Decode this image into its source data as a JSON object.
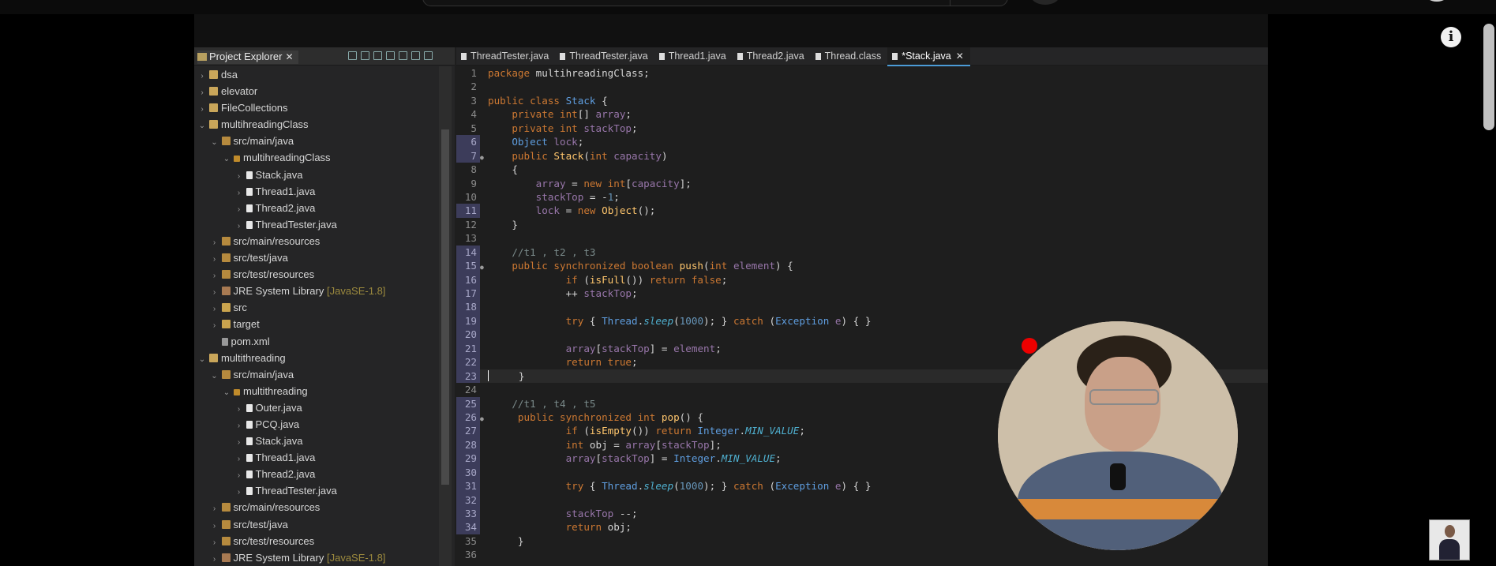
{
  "project_explorer": {
    "title": "Project Explorer",
    "close": "✕",
    "items": [
      {
        "depth": 0,
        "arrow": "›",
        "icon": "proj",
        "label": "dsa",
        "extra": ""
      },
      {
        "depth": 0,
        "arrow": "›",
        "icon": "proj",
        "label": "elevator",
        "extra": ""
      },
      {
        "depth": 0,
        "arrow": "›",
        "icon": "proj",
        "label": "FileCollections",
        "extra": ""
      },
      {
        "depth": 0,
        "arrow": "⌄",
        "icon": "proj",
        "label": "multihreadingClass",
        "extra": ""
      },
      {
        "depth": 1,
        "arrow": "⌄",
        "icon": "pkgf",
        "label": "src/main/java",
        "extra": ""
      },
      {
        "depth": 2,
        "arrow": "⌄",
        "icon": "pkg",
        "label": "multihreadingClass",
        "extra": ""
      },
      {
        "depth": 3,
        "arrow": "›",
        "icon": "java",
        "label": "Stack.java",
        "extra": ""
      },
      {
        "depth": 3,
        "arrow": "›",
        "icon": "java",
        "label": "Thread1.java",
        "extra": ""
      },
      {
        "depth": 3,
        "arrow": "›",
        "icon": "java",
        "label": "Thread2.java",
        "extra": ""
      },
      {
        "depth": 3,
        "arrow": "›",
        "icon": "java",
        "label": "ThreadTester.java",
        "extra": ""
      },
      {
        "depth": 1,
        "arrow": "›",
        "icon": "pkgf",
        "label": "src/main/resources",
        "extra": ""
      },
      {
        "depth": 1,
        "arrow": "›",
        "icon": "pkgf",
        "label": "src/test/java",
        "extra": ""
      },
      {
        "depth": 1,
        "arrow": "›",
        "icon": "pkgf",
        "label": "src/test/resources",
        "extra": ""
      },
      {
        "depth": 1,
        "arrow": "›",
        "icon": "lib",
        "label": "JRE System Library",
        "extra": " [JavaSE-1.8]"
      },
      {
        "depth": 1,
        "arrow": "›",
        "icon": "folder",
        "label": "src",
        "extra": ""
      },
      {
        "depth": 1,
        "arrow": "›",
        "icon": "folder",
        "label": "target",
        "extra": ""
      },
      {
        "depth": 1,
        "arrow": "",
        "icon": "xml",
        "label": "pom.xml",
        "extra": ""
      },
      {
        "depth": 0,
        "arrow": "⌄",
        "icon": "proj",
        "label": "multithreading",
        "extra": ""
      },
      {
        "depth": 1,
        "arrow": "⌄",
        "icon": "pkgf",
        "label": "src/main/java",
        "extra": ""
      },
      {
        "depth": 2,
        "arrow": "⌄",
        "icon": "pkg",
        "label": "multithreading",
        "extra": ""
      },
      {
        "depth": 3,
        "arrow": "›",
        "icon": "java",
        "label": "Outer.java",
        "extra": ""
      },
      {
        "depth": 3,
        "arrow": "›",
        "icon": "java",
        "label": "PCQ.java",
        "extra": ""
      },
      {
        "depth": 3,
        "arrow": "›",
        "icon": "java",
        "label": "Stack.java",
        "extra": ""
      },
      {
        "depth": 3,
        "arrow": "›",
        "icon": "java",
        "label": "Thread1.java",
        "extra": ""
      },
      {
        "depth": 3,
        "arrow": "›",
        "icon": "java",
        "label": "Thread2.java",
        "extra": ""
      },
      {
        "depth": 3,
        "arrow": "›",
        "icon": "java",
        "label": "ThreadTester.java",
        "extra": ""
      },
      {
        "depth": 1,
        "arrow": "›",
        "icon": "pkgf",
        "label": "src/main/resources",
        "extra": ""
      },
      {
        "depth": 1,
        "arrow": "›",
        "icon": "pkgf",
        "label": "src/test/java",
        "extra": ""
      },
      {
        "depth": 1,
        "arrow": "›",
        "icon": "pkgf",
        "label": "src/test/resources",
        "extra": ""
      },
      {
        "depth": 1,
        "arrow": "›",
        "icon": "lib",
        "label": "JRE System Library",
        "extra": " [JavaSE-1.8]"
      }
    ]
  },
  "editor": {
    "tabs": [
      {
        "label": "ThreadTester.java",
        "active": false,
        "close": ""
      },
      {
        "label": "ThreadTester.java",
        "active": false,
        "close": ""
      },
      {
        "label": "Thread1.java",
        "active": false,
        "close": ""
      },
      {
        "label": "Thread2.java",
        "active": false,
        "close": ""
      },
      {
        "label": "Thread.class",
        "active": false,
        "close": ""
      },
      {
        "label": "*Stack.java",
        "active": true,
        "close": "✕"
      }
    ],
    "lines": [
      {
        "n": "1",
        "mark": false,
        "fold": "",
        "cur": false,
        "t": [
          [
            "kw",
            "package "
          ],
          [
            "pl",
            "multihreadingClass;"
          ]
        ]
      },
      {
        "n": "2",
        "mark": false,
        "fold": "",
        "cur": false,
        "t": []
      },
      {
        "n": "3",
        "mark": false,
        "fold": "",
        "cur": false,
        "t": [
          [
            "kw",
            "public class "
          ],
          [
            "cls",
            "Stack"
          ],
          [
            "pl",
            " {"
          ]
        ]
      },
      {
        "n": "4",
        "mark": false,
        "fold": "",
        "cur": false,
        "t": [
          [
            "pl",
            "    "
          ],
          [
            "kw",
            "private int"
          ],
          [
            "pl",
            "[] "
          ],
          [
            "var",
            "array"
          ],
          [
            "pl",
            ";"
          ]
        ]
      },
      {
        "n": "5",
        "mark": false,
        "fold": "",
        "cur": false,
        "t": [
          [
            "pl",
            "    "
          ],
          [
            "kw",
            "private int "
          ],
          [
            "var",
            "stackTop"
          ],
          [
            "pl",
            ";"
          ]
        ]
      },
      {
        "n": "6",
        "mark": true,
        "fold": "",
        "cur": false,
        "t": [
          [
            "pl",
            "    "
          ],
          [
            "cls",
            "Object "
          ],
          [
            "var",
            "lock"
          ],
          [
            "pl",
            ";"
          ]
        ]
      },
      {
        "n": "7",
        "mark": true,
        "fold": "●",
        "cur": false,
        "t": [
          [
            "pl",
            "    "
          ],
          [
            "kw",
            "public "
          ],
          [
            "fn",
            "Stack"
          ],
          [
            "pl",
            "("
          ],
          [
            "kw",
            "int "
          ],
          [
            "var",
            "capacity"
          ],
          [
            "pl",
            ")"
          ]
        ]
      },
      {
        "n": "8",
        "mark": false,
        "fold": "",
        "cur": false,
        "t": [
          [
            "pl",
            "    {"
          ]
        ]
      },
      {
        "n": "9",
        "mark": false,
        "fold": "",
        "cur": false,
        "t": [
          [
            "pl",
            "        "
          ],
          [
            "var",
            "array"
          ],
          [
            "pl",
            " = "
          ],
          [
            "kw",
            "new int"
          ],
          [
            "pl",
            "["
          ],
          [
            "var",
            "capacity"
          ],
          [
            "pl",
            "];"
          ]
        ]
      },
      {
        "n": "10",
        "mark": false,
        "fold": "",
        "cur": false,
        "t": [
          [
            "pl",
            "        "
          ],
          [
            "var",
            "stackTop"
          ],
          [
            "pl",
            " = -"
          ],
          [
            "num",
            "1"
          ],
          [
            "pl",
            ";"
          ]
        ]
      },
      {
        "n": "11",
        "mark": true,
        "fold": "",
        "cur": false,
        "t": [
          [
            "pl",
            "        "
          ],
          [
            "var",
            "lock"
          ],
          [
            "pl",
            " = "
          ],
          [
            "kw",
            "new "
          ],
          [
            "fn",
            "Object"
          ],
          [
            "pl",
            "();"
          ]
        ]
      },
      {
        "n": "12",
        "mark": false,
        "fold": "",
        "cur": false,
        "t": [
          [
            "pl",
            "    }"
          ]
        ]
      },
      {
        "n": "13",
        "mark": false,
        "fold": "",
        "cur": false,
        "t": []
      },
      {
        "n": "14",
        "mark": true,
        "fold": "",
        "cur": false,
        "t": [
          [
            "pl",
            "    "
          ],
          [
            "cmt",
            "//t1 , t2 , t3"
          ]
        ]
      },
      {
        "n": "15",
        "mark": true,
        "fold": "●",
        "cur": false,
        "t": [
          [
            "pl",
            "    "
          ],
          [
            "kw",
            "public synchronized boolean "
          ],
          [
            "fn",
            "push"
          ],
          [
            "pl",
            "("
          ],
          [
            "kw",
            "int "
          ],
          [
            "var",
            "element"
          ],
          [
            "pl",
            ") {"
          ]
        ]
      },
      {
        "n": "16",
        "mark": true,
        "fold": "",
        "cur": false,
        "t": [
          [
            "pl",
            "             "
          ],
          [
            "kw",
            "if "
          ],
          [
            "pl",
            "("
          ],
          [
            "fn",
            "isFull"
          ],
          [
            "pl",
            "()) "
          ],
          [
            "kw",
            "return false"
          ],
          [
            "pl",
            ";"
          ]
        ]
      },
      {
        "n": "17",
        "mark": true,
        "fold": "",
        "cur": false,
        "t": [
          [
            "pl",
            "             ++ "
          ],
          [
            "var",
            "stackTop"
          ],
          [
            "pl",
            ";"
          ]
        ]
      },
      {
        "n": "18",
        "mark": true,
        "fold": "",
        "cur": false,
        "t": []
      },
      {
        "n": "19",
        "mark": true,
        "fold": "",
        "cur": false,
        "t": [
          [
            "pl",
            "             "
          ],
          [
            "kw",
            "try "
          ],
          [
            "pl",
            "{ "
          ],
          [
            "cls",
            "Thread"
          ],
          [
            "pl",
            "."
          ],
          [
            "it",
            "sleep"
          ],
          [
            "pl",
            "("
          ],
          [
            "num",
            "1000"
          ],
          [
            "pl",
            "); } "
          ],
          [
            "kw",
            "catch "
          ],
          [
            "pl",
            "("
          ],
          [
            "cls",
            "Exception "
          ],
          [
            "var",
            "e"
          ],
          [
            "pl",
            ") { }"
          ]
        ]
      },
      {
        "n": "20",
        "mark": true,
        "fold": "",
        "cur": false,
        "t": []
      },
      {
        "n": "21",
        "mark": true,
        "fold": "",
        "cur": false,
        "t": [
          [
            "pl",
            "             "
          ],
          [
            "var",
            "array"
          ],
          [
            "pl",
            "["
          ],
          [
            "var",
            "stackTop"
          ],
          [
            "pl",
            "] = "
          ],
          [
            "var",
            "element"
          ],
          [
            "pl",
            ";"
          ]
        ]
      },
      {
        "n": "22",
        "mark": true,
        "fold": "",
        "cur": false,
        "t": [
          [
            "pl",
            "             "
          ],
          [
            "kw",
            "return true"
          ],
          [
            "pl",
            ";"
          ]
        ]
      },
      {
        "n": "23",
        "mark": true,
        "fold": "",
        "cur": true,
        "t": [
          [
            "pl",
            "     }"
          ]
        ]
      },
      {
        "n": "24",
        "mark": false,
        "fold": "",
        "cur": false,
        "t": []
      },
      {
        "n": "25",
        "mark": true,
        "fold": "",
        "cur": false,
        "t": [
          [
            "pl",
            "    "
          ],
          [
            "cmt",
            "//t1 , t4 , t5"
          ]
        ]
      },
      {
        "n": "26",
        "mark": true,
        "fold": "●",
        "cur": false,
        "t": [
          [
            "pl",
            "     "
          ],
          [
            "kw",
            "public synchronized int "
          ],
          [
            "fn",
            "pop"
          ],
          [
            "pl",
            "() {"
          ]
        ]
      },
      {
        "n": "27",
        "mark": true,
        "fold": "",
        "cur": false,
        "t": [
          [
            "pl",
            "             "
          ],
          [
            "kw",
            "if "
          ],
          [
            "pl",
            "("
          ],
          [
            "fn",
            "isEmpty"
          ],
          [
            "pl",
            "()) "
          ],
          [
            "kw",
            "return "
          ],
          [
            "cls",
            "Integer"
          ],
          [
            "pl",
            "."
          ],
          [
            "it",
            "MIN_VALUE"
          ],
          [
            "pl",
            ";"
          ]
        ]
      },
      {
        "n": "28",
        "mark": true,
        "fold": "",
        "cur": false,
        "t": [
          [
            "pl",
            "             "
          ],
          [
            "kw",
            "int "
          ],
          [
            "pl",
            "obj = "
          ],
          [
            "var",
            "array"
          ],
          [
            "pl",
            "["
          ],
          [
            "var",
            "stackTop"
          ],
          [
            "pl",
            "];"
          ]
        ]
      },
      {
        "n": "29",
        "mark": true,
        "fold": "",
        "cur": false,
        "t": [
          [
            "pl",
            "             "
          ],
          [
            "var",
            "array"
          ],
          [
            "pl",
            "["
          ],
          [
            "var",
            "stackTop"
          ],
          [
            "pl",
            "] = "
          ],
          [
            "cls",
            "Integer"
          ],
          [
            "pl",
            "."
          ],
          [
            "it",
            "MIN_VALUE"
          ],
          [
            "pl",
            ";"
          ]
        ]
      },
      {
        "n": "30",
        "mark": true,
        "fold": "",
        "cur": false,
        "t": []
      },
      {
        "n": "31",
        "mark": true,
        "fold": "",
        "cur": false,
        "t": [
          [
            "pl",
            "             "
          ],
          [
            "kw",
            "try "
          ],
          [
            "pl",
            "{ "
          ],
          [
            "cls",
            "Thread"
          ],
          [
            "pl",
            "."
          ],
          [
            "it",
            "sleep"
          ],
          [
            "pl",
            "("
          ],
          [
            "num",
            "1000"
          ],
          [
            "pl",
            "); } "
          ],
          [
            "kw",
            "catch "
          ],
          [
            "pl",
            "("
          ],
          [
            "cls",
            "Exception "
          ],
          [
            "var",
            "e"
          ],
          [
            "pl",
            ") { }"
          ]
        ]
      },
      {
        "n": "32",
        "mark": true,
        "fold": "",
        "cur": false,
        "t": []
      },
      {
        "n": "33",
        "mark": true,
        "fold": "",
        "cur": false,
        "t": [
          [
            "pl",
            "             "
          ],
          [
            "var",
            "stackTop"
          ],
          [
            "pl",
            " --;"
          ]
        ]
      },
      {
        "n": "34",
        "mark": true,
        "fold": "",
        "cur": false,
        "t": [
          [
            "pl",
            "             "
          ],
          [
            "kw",
            "return "
          ],
          [
            "pl",
            "obj;"
          ]
        ]
      },
      {
        "n": "35",
        "mark": false,
        "fold": "",
        "cur": false,
        "t": [
          [
            "pl",
            "     }"
          ]
        ]
      },
      {
        "n": "36",
        "mark": false,
        "fold": "",
        "cur": false,
        "t": []
      }
    ]
  },
  "overlay": {
    "info_icon": "i",
    "icons": [
      "info-icon",
      "record-indicator-icon",
      "webcam-feed",
      "channel-thumbnail"
    ]
  },
  "colors": {
    "keyword": "#cc7832",
    "type": "#5f9ee0",
    "method": "#ffc66d",
    "number": "#6897bb",
    "field": "#9876aa",
    "comment": "#7a8a8a",
    "record": "#ee0000"
  }
}
